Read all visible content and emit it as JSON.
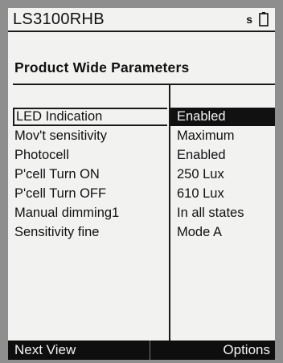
{
  "header": {
    "device_name": "LS3100RHB",
    "status_indicator": "s",
    "battery_icon": "battery-icon"
  },
  "page": {
    "title": "Product Wide Parameters"
  },
  "parameters": [
    {
      "name": "LED Indication",
      "value": "Enabled",
      "selected": true
    },
    {
      "name": "Mov't sensitivity",
      "value": "Maximum",
      "selected": false
    },
    {
      "name": "Photocell",
      "value": "Enabled",
      "selected": false
    },
    {
      "name": "P'cell Turn ON",
      "value": "250 Lux",
      "selected": false
    },
    {
      "name": "P'cell Turn OFF",
      "value": "610 Lux",
      "selected": false
    },
    {
      "name": "Manual dimming1",
      "value": "In all states",
      "selected": false
    },
    {
      "name": "Sensitivity fine",
      "value": "Mode A",
      "selected": false
    }
  ],
  "softkeys": {
    "left": "Next View",
    "right": "Options"
  },
  "colors": {
    "screen_background": "#f2f2f1",
    "bezel": "#8e8e8e",
    "highlight": "#111111",
    "highlight_text": "#f5f5f5"
  }
}
